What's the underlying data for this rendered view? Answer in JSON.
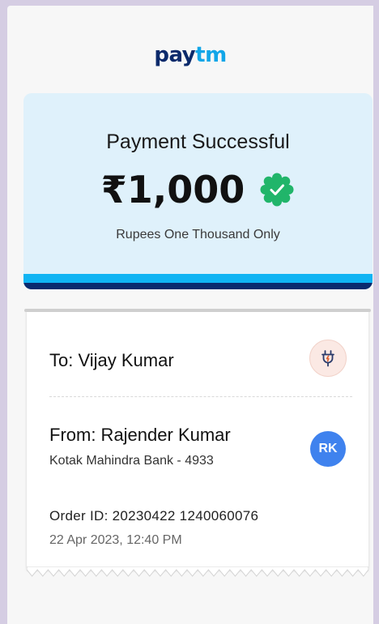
{
  "brand": {
    "logo_pay": "pay",
    "logo_tm": "tm",
    "pay_color": "#0b2a6b",
    "tm_color": "#12a6e8"
  },
  "status": {
    "title": "Payment Successful",
    "amount": "₹1,000",
    "amount_words": "Rupees One Thousand Only",
    "badge_icon": "verified-check-icon",
    "badge_color": "#21b56a"
  },
  "receipt": {
    "to_label": "To: Vijay Kumar",
    "to_icon": "electric-plug-icon",
    "from_label": "From: Rajender Kumar",
    "from_bank": "Kotak Mahindra Bank - 4933",
    "from_initials": "RK",
    "order_id": "Order ID: 20230422 1240060076",
    "timestamp": "22 Apr 2023, 12:40 PM"
  }
}
